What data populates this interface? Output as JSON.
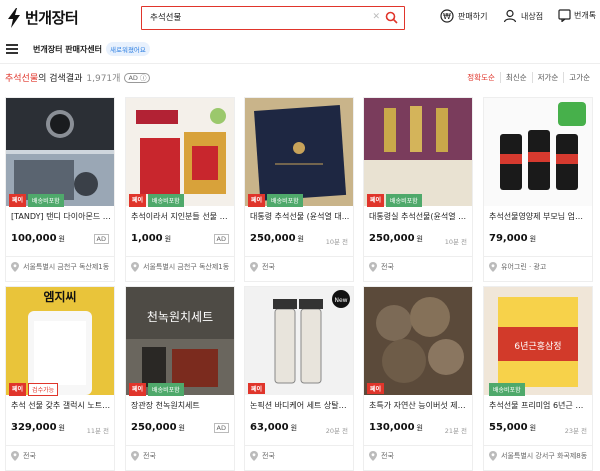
{
  "header": {
    "logo_text": "번개장터",
    "search_value": "추석선물",
    "tools": [
      "판매하기",
      "내상점",
      "번개톡"
    ]
  },
  "nav": {
    "seller_center": "번개장터 판매자센터",
    "new_badge": "새로워졌어요"
  },
  "results": {
    "keyword": "추석선물",
    "suffix": "의 검색결과",
    "count": "1,971개",
    "ad": "AD"
  },
  "sort_options": [
    "정확도순",
    "최신순",
    "저가순",
    "고가순"
  ],
  "products": [
    {
      "title": "[TANDY] 탠디 다이아몬드 메...",
      "price": "100,000",
      "time": "",
      "ad": "AD",
      "location": "서울특별시 금천구 독산제1동",
      "pay": "페이",
      "ship": "배송비포함"
    },
    {
      "title": "추석이라서 지인분들 선물 드...",
      "price": "1,000",
      "time": "",
      "ad": "AD",
      "location": "서울특별시 금천구 독산제1동",
      "pay": "페이",
      "ship": "배송비포함"
    },
    {
      "title": "대통령 추석선물 (윤석열 대...",
      "price": "250,000",
      "time": "10분 전",
      "ad": "",
      "location": "전국",
      "pay": "페이",
      "ship": "배송비포함"
    },
    {
      "title": "대통령실 추석선물(윤석열 대...",
      "price": "250,000",
      "time": "10분 전",
      "ad": "",
      "location": "전국",
      "pay": "페이",
      "ship": "배송비포함"
    },
    {
      "title": "추석선물영양제 부모님 엄마 ...",
      "price": "79,000",
      "time": "",
      "ad": "",
      "location": "유어그린 · 광고",
      "pay": "",
      "ship": ""
    },
    {
      "title": "추석 선물 갖추 갤럭시 노트 2...",
      "price": "329,000",
      "time": "11분 전",
      "ad": "",
      "location": "전국",
      "pay": "페이",
      "ship": "검수가능"
    },
    {
      "title": "장관장 천녹원치세트",
      "price": "250,000",
      "time": "",
      "ad": "AD",
      "location": "전국",
      "pay": "페이",
      "ship": "배송비포함"
    },
    {
      "title": "논픽션 바디케어 세트 상탈크...",
      "price": "63,000",
      "time": "20분 전",
      "ad": "",
      "location": "전국",
      "pay": "페이",
      "ship": ""
    },
    {
      "title": "초특가 자연산 능이버섯 제철 ...",
      "price": "130,000",
      "time": "21분 전",
      "ad": "",
      "location": "전국",
      "pay": "페이",
      "ship": ""
    },
    {
      "title": "추석선물 프리미엄 6년근 홍...",
      "price": "55,000",
      "time": "23분 전",
      "ad": "",
      "location": "서울특별시 강서구 화곡제8동",
      "pay": "",
      "ship": "배송비포함"
    }
  ],
  "currency_unit": "원",
  "colors": {
    "accent": "#e0352b",
    "text": "#212121"
  }
}
